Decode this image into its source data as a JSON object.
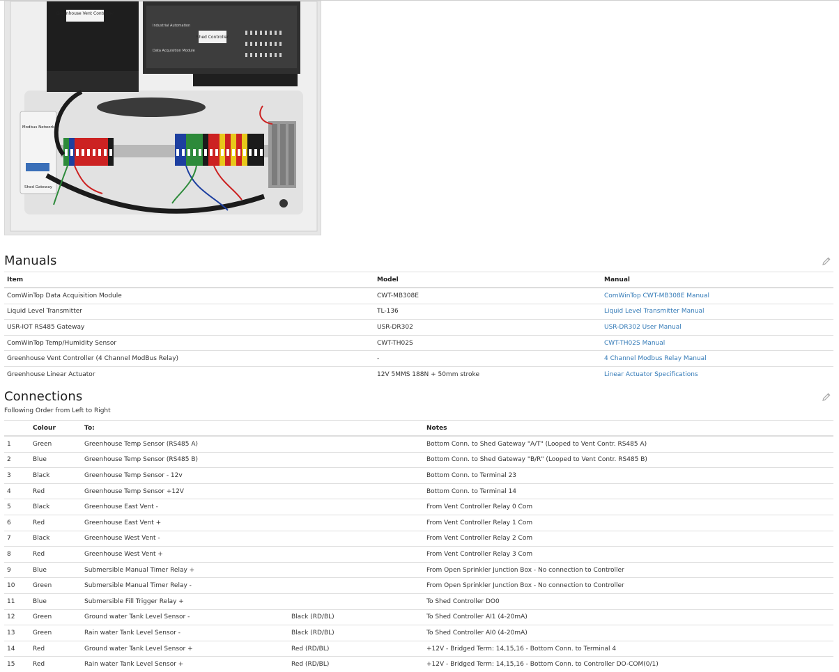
{
  "photo": {
    "labels": {
      "vent_controller": "Greenhouse Vent Controller",
      "shed_controller": "Shed Controller",
      "industrial": "Industrial Automation",
      "daq": "Data Acquisition Module",
      "modbus": "Modbus Network",
      "gateway": "Shed Gateway"
    }
  },
  "manuals": {
    "title": "Manuals",
    "headers": {
      "item": "Item",
      "model": "Model",
      "manual": "Manual"
    },
    "rows": [
      {
        "item": "ComWinTop Data Acquisition Module",
        "model": "CWT-MB308E",
        "manual": "ComWinTop CWT-MB308E Manual"
      },
      {
        "item": "Liquid Level Transmitter",
        "model": "TL-136",
        "manual": "Liquid Level Transmitter Manual"
      },
      {
        "item": "USR-IOT RS485 Gateway",
        "model": "USR-DR302",
        "manual": "USR-DR302 User Manual"
      },
      {
        "item": "ComWinTop Temp/Humidity Sensor",
        "model": "CWT-TH02S",
        "manual": "CWT-TH02S Manual"
      },
      {
        "item": "Greenhouse Vent Controller (4 Channel ModBus Relay)",
        "model": "-",
        "manual": "4 Channel Modbus Relay Manual"
      },
      {
        "item": "Greenhouse Linear Actuator",
        "model": "12V 5MMS 188N + 50mm stroke",
        "manual": "Linear Actuator Specifications"
      }
    ]
  },
  "connections": {
    "title": "Connections",
    "subtitle": "Following Order from Left to Right",
    "headers": {
      "num": "",
      "colour": "Colour",
      "to": "To:",
      "extra": "",
      "notes": "Notes"
    },
    "rows": [
      {
        "num": "1",
        "colour": "Green",
        "to": "Greenhouse Temp Sensor (RS485 A)",
        "extra": "",
        "notes": "Bottom Conn. to Shed Gateway \"A/T\" (Looped to Vent Contr. RS485 A)"
      },
      {
        "num": "2",
        "colour": "Blue",
        "to": "Greenhouse Temp Sensor (RS485 B)",
        "extra": "",
        "notes": "Bottom Conn. to Shed Gateway \"B/R\" (Looped to Vent Contr. RS485 B)"
      },
      {
        "num": "3",
        "colour": "Black",
        "to": "Greenhouse Temp Sensor - 12v",
        "extra": "",
        "notes": "Bottom Conn. to Terminal 23"
      },
      {
        "num": "4",
        "colour": "Red",
        "to": "Greenhouse Temp Sensor +12V",
        "extra": "",
        "notes": "Bottom Conn. to Terminal 14"
      },
      {
        "num": "5",
        "colour": "Black",
        "to": "Greenhouse East Vent -",
        "extra": "",
        "notes": "From Vent Controller Relay 0 Com"
      },
      {
        "num": "6",
        "colour": "Red",
        "to": "Greenhouse East Vent +",
        "extra": "",
        "notes": "From Vent Controller Relay 1 Com"
      },
      {
        "num": "7",
        "colour": "Black",
        "to": "Greenhouse West Vent -",
        "extra": "",
        "notes": "From Vent Controller Relay 2 Com"
      },
      {
        "num": "8",
        "colour": "Red",
        "to": "Greenhouse West Vent +",
        "extra": "",
        "notes": "From Vent Controller Relay 3 Com"
      },
      {
        "num": "9",
        "colour": "Blue",
        "to": "Submersible Manual Timer Relay +",
        "extra": "",
        "notes": "From Open Sprinkler Junction Box - No connection to Controller"
      },
      {
        "num": "10",
        "colour": "Green",
        "to": "Submersible Manual Timer Relay -",
        "extra": "",
        "notes": "From Open Sprinkler Junction Box - No connection to Controller"
      },
      {
        "num": "11",
        "colour": "Blue",
        "to": "Submersible Fill Trigger Relay +",
        "extra": "",
        "notes": "To Shed Controller DO0"
      },
      {
        "num": "12",
        "colour": "Green",
        "to": "Ground water Tank Level Sensor -",
        "extra": "Black (RD/BL)",
        "notes": "To Shed Controller AI1 (4-20mA)"
      },
      {
        "num": "13",
        "colour": "Green",
        "to": "Rain water Tank Level Sensor -",
        "extra": "Black (RD/BL)",
        "notes": "To Shed Controller AI0 (4-20mA)"
      },
      {
        "num": "14",
        "colour": "Red",
        "to": "Ground water Tank Level Sensor +",
        "extra": "Red (RD/BL)",
        "notes": "+12V - Bridged Term: 14,15,16 - Bottom Conn. to Terminal 4"
      },
      {
        "num": "15",
        "colour": "Red",
        "to": "Rain water Tank Level Sensor +",
        "extra": "Red (RD/BL)",
        "notes": "+12V - Bridged Term: 14,15,16 - Bottom Conn. to Controller DO-COM(0/1)"
      }
    ]
  },
  "colors": {
    "link": "#337ab7",
    "border": "#dddddd"
  },
  "icons": {
    "edit": "pencil-icon"
  }
}
